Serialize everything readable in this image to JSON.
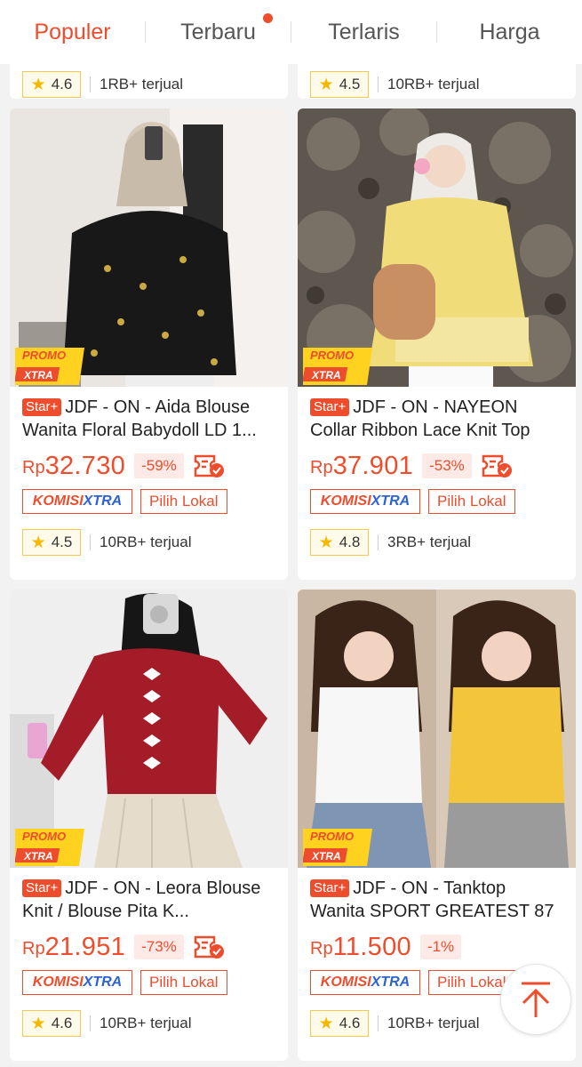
{
  "sort_tabs": [
    {
      "label": "Populer",
      "active": true
    },
    {
      "label": "Terbaru",
      "has_dot": true
    },
    {
      "label": "Terlaris"
    },
    {
      "label": "Harga"
    }
  ],
  "previous_row": [
    {
      "rating": "4.6",
      "sold": "1RB+ terjual"
    },
    {
      "rating": "4.5",
      "sold": "10RB+ terjual"
    }
  ],
  "products": [
    {
      "badge": "Star+",
      "title": "JDF - ON - Aida Blouse Wanita Floral Babydoll LD 1...",
      "currency": "Rp",
      "price": "32.730",
      "discount": "-59%",
      "komisi_a": "KOMISI",
      "komisi_b": "XTRA",
      "tag": "Pilih Lokal",
      "rating": "4.5",
      "sold": "10RB+ terjual",
      "promo_a": "PROMO",
      "promo_b": "XTRA"
    },
    {
      "badge": "Star+",
      "title": "JDF - ON - NAYEON Collar Ribbon Lace Knit Top",
      "currency": "Rp",
      "price": "37.901",
      "discount": "-53%",
      "komisi_a": "KOMISI",
      "komisi_b": "XTRA",
      "tag": "Pilih Lokal",
      "rating": "4.8",
      "sold": "3RB+ terjual",
      "promo_a": "PROMO",
      "promo_b": "XTRA"
    },
    {
      "badge": "Star+",
      "title": "JDF - ON - Leora Blouse Knit / Blouse Pita K...",
      "currency": "Rp",
      "price": "21.951",
      "discount": "-73%",
      "komisi_a": "KOMISI",
      "komisi_b": "XTRA",
      "tag": "Pilih Lokal",
      "rating": "4.6",
      "sold": "10RB+ terjual",
      "promo_a": "PROMO",
      "promo_b": "XTRA"
    },
    {
      "badge": "Star+",
      "title": "JDF - ON - Tanktop Wanita SPORT GREATEST 87",
      "currency": "Rp",
      "price": "11.500",
      "discount": "-1%",
      "komisi_a": "KOMISI",
      "komisi_b": "XTRA",
      "tag": "Pilih Lokal",
      "rating": "4.6",
      "sold": "10RB+ terjual",
      "promo_a": "PROMO",
      "promo_b": "XTRA"
    }
  ],
  "colors": {
    "accent": "#ee4d2d",
    "komisi_blue": "#2d62d6",
    "star": "#f5b800"
  },
  "icons": {
    "back_to_top": "arrow-up-icon",
    "rating": "star-icon",
    "payment": "paylater-check-icon"
  }
}
